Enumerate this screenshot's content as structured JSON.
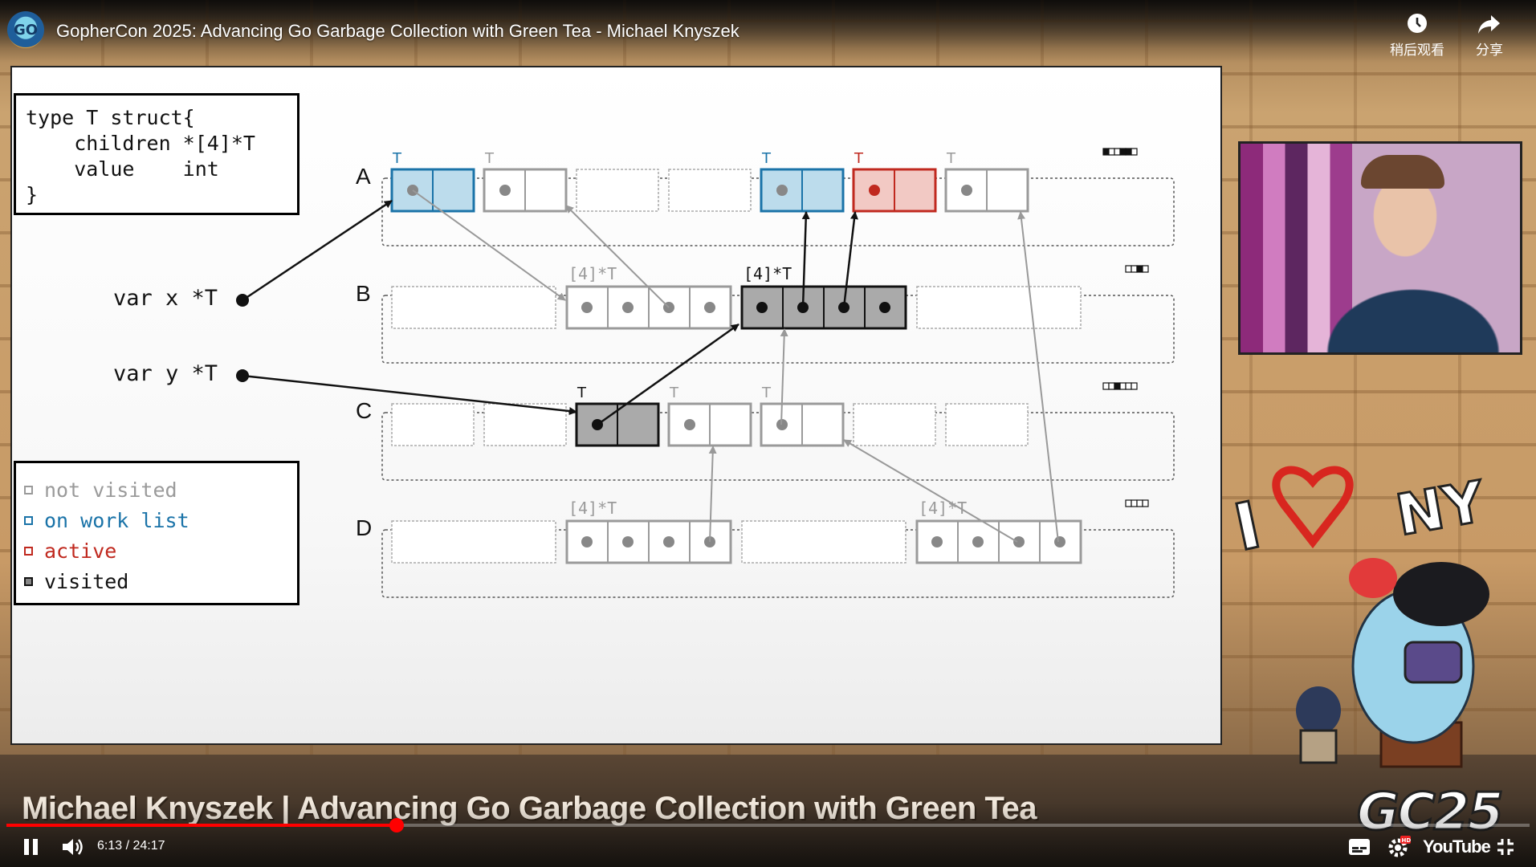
{
  "player": {
    "title": "GopherCon 2025: Advancing Go Garbage Collection with Green Tea - Michael Knyszek",
    "channel_avatar_text": "GO",
    "watch_later_label": "稍后观看",
    "share_label": "分享",
    "current_time": "6:13",
    "duration": "24:17",
    "time_display": "6:13 / 24:17",
    "progress_fraction": 0.256,
    "youtube_label": "YouTube",
    "icons": {
      "watch_later": "clock-icon",
      "share": "share-arrow-icon",
      "play_pause": "pause-icon",
      "volume": "volume-icon",
      "subtitles": "subtitles-icon",
      "settings": "gear-hd-icon",
      "fullscreen": "exit-fullscreen-icon"
    }
  },
  "stage": {
    "lower_third": "Michael Knyszek | Advancing Go Garbage Collection with Green Tea",
    "sign_left": "I",
    "sign_right": "NY",
    "logo": "GC25"
  },
  "slide": {
    "code": "type T struct{\n    children *[4]*T\n    value    int\n}",
    "legend": [
      {
        "label": "not visited",
        "color": "#9a9a9a"
      },
      {
        "label": "on work list",
        "color": "#1a73a8"
      },
      {
        "label": "active",
        "color": "#c0291f"
      },
      {
        "label": "visited",
        "color": "#111111"
      }
    ],
    "var_x": "var x *T",
    "var_y": "var y *T",
    "rows": [
      "A",
      "B",
      "C",
      "D"
    ],
    "type_labels": {
      "t": "T",
      "arr": "[4]*T"
    },
    "colors": {
      "not_visited": "#9a9a9a",
      "work_list": "#1a73a8",
      "work_list_fill": "#bcdcec",
      "active": "#c0291f",
      "active_fill": "#f2c9c4",
      "visited": "#111111",
      "visited_fill": "#aaaaaa"
    }
  }
}
